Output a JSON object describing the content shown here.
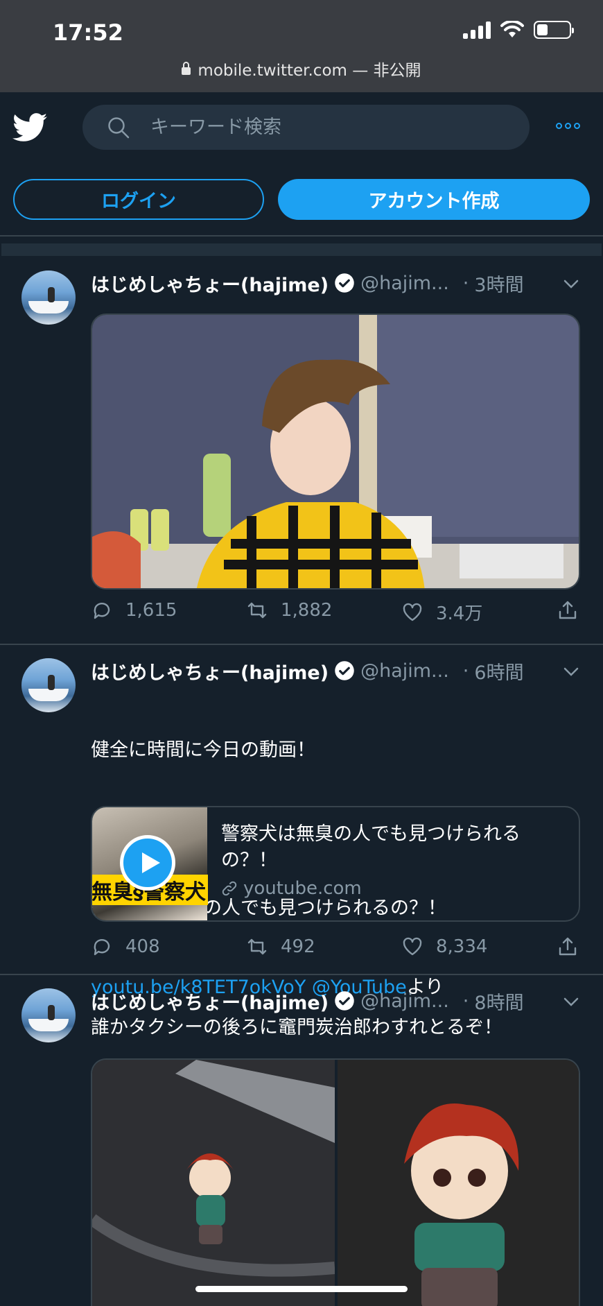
{
  "status_bar": {
    "time": "17:52",
    "url": "mobile.twitter.com",
    "url_suffix": " — 非公開",
    "battery_level": 0.35
  },
  "header": {
    "search_placeholder": "キーワード検索",
    "login_label": "ログイン",
    "signup_label": "アカウント作成"
  },
  "colors": {
    "background": "#15202b",
    "accent": "#1da1f2",
    "secondary_text": "#8899a6",
    "divider": "#38444d"
  },
  "tweets": [
    {
      "name": "はじめしゃちょー(hajime)",
      "handle": "@hajim...",
      "time": "3時間",
      "replies": "1,615",
      "retweets": "1,882",
      "likes": "3.4万"
    },
    {
      "name": "はじめしゃちょー(hajime)",
      "handle": "@hajim...",
      "time": "6時間",
      "text_line1": "健全に時間に今日の動画！",
      "text_line2": "警察犬は無臭の人でも見つけられるの？！",
      "link_url": "youtu.be/k8TET7okVoY",
      "link_mention": "@YouTube",
      "text_suffix": "より",
      "card_title": "警察犬は無臭の人でも見つけられるの？！",
      "card_domain": "youtube.com",
      "card_thumb_text": "無臭§警察犬",
      "replies": "408",
      "retweets": "492",
      "likes": "8,334"
    },
    {
      "name": "はじめしゃちょー(hajime)",
      "handle": "@hajim...",
      "time": "8時間",
      "text": "誰かタクシーの後ろに竈門炭治郎わすれとるぞ！"
    }
  ]
}
